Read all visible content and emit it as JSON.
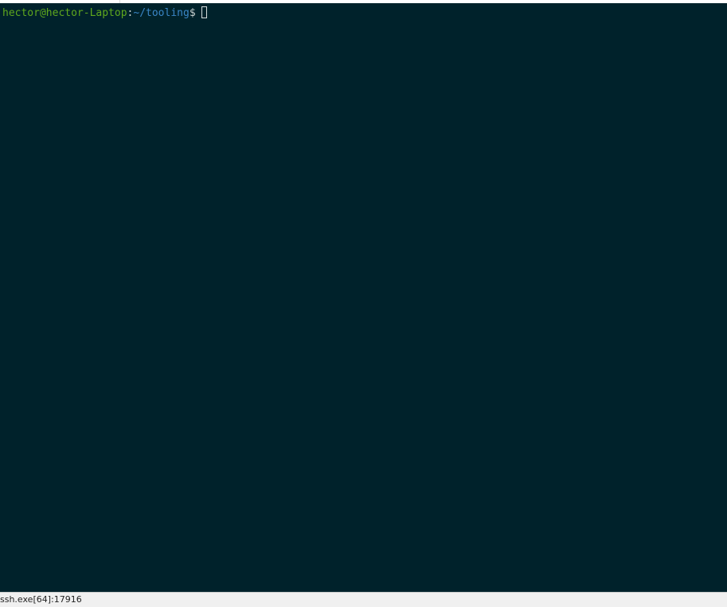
{
  "terminal": {
    "prompt": {
      "user_host": "hector@hector-Laptop",
      "colon": ":",
      "path": "~/tooling",
      "dollar": "$ "
    },
    "colors": {
      "background": "#00222b",
      "user_host": "#5fa81d",
      "path": "#3a86c6",
      "text": "#c7d0cf"
    }
  },
  "status_bar": {
    "process": "ssh.exe[64]:17916"
  }
}
